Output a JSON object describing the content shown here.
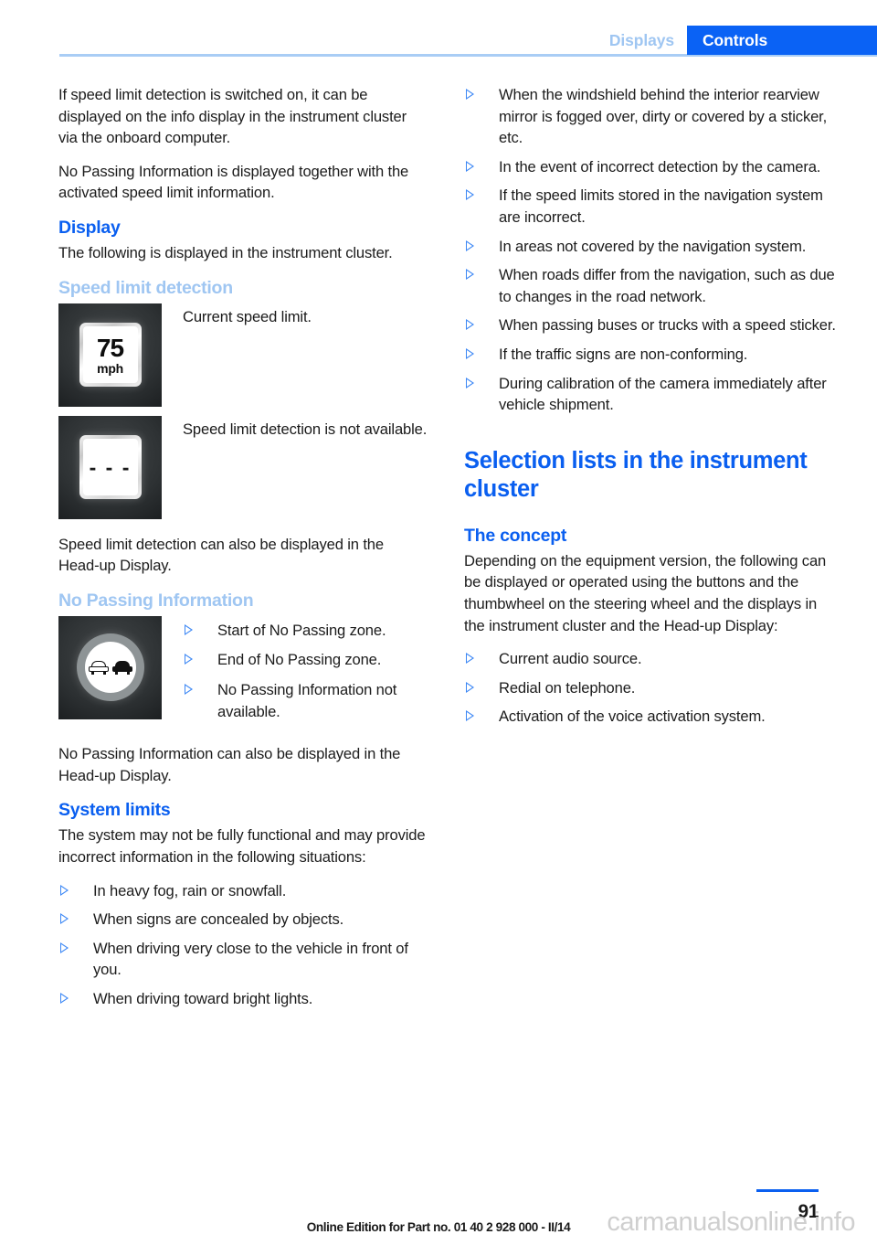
{
  "header": {
    "tab_inactive": "Displays",
    "tab_active": "Controls",
    "accent_blue": "#0a62f5",
    "light_blue": "#9fc6f2"
  },
  "left_column": {
    "intro_p1": "If speed limit detection is switched on, it can be displayed on the info display in the instrument cluster via the onboard computer.",
    "intro_p2": "No Passing Information is displayed together with the activated speed limit information.",
    "display_heading": "Display",
    "display_text": "The following is displayed in the instrument cluster.",
    "speed_limit_heading": "Speed limit detection",
    "fig_speed_limit": {
      "icon_value": "75",
      "icon_unit": "mph",
      "caption": "Current speed limit."
    },
    "fig_not_available": {
      "icon_value": "- - -",
      "caption": "Speed limit detection is not available."
    },
    "hud_note_1": "Speed limit detection can also be displayed in the Head-up Display.",
    "no_passing_heading": "No Passing Information",
    "fig_no_passing": {
      "items": [
        "Start of No Passing zone.",
        "End of No Passing zone.",
        "No Passing Information not available."
      ]
    },
    "hud_note_2": "No Passing Information can also be displayed in the Head-up Display.",
    "system_limits_heading": "System limits",
    "system_limits_text": "The system may not be fully functional and may provide incorrect information in the following situations:",
    "system_limits_items": [
      "In heavy fog, rain or snowfall.",
      "When signs are concealed by objects.",
      "When driving very close to the vehicle in front of you.",
      "When driving toward bright lights."
    ]
  },
  "right_column": {
    "system_limits_items_cont": [
      "When the windshield behind the interior rearview mirror is fogged over, dirty or covered by a sticker, etc.",
      "In the event of incorrect detection by the camera.",
      "If the speed limits stored in the navigation system are incorrect.",
      "In areas not covered by the navigation system.",
      "When roads differ from the navigation, such as due to changes in the road network.",
      "When passing buses or trucks with a speed sticker.",
      "If the traffic signs are non-conforming.",
      "During calibration of the camera immediately after vehicle shipment."
    ],
    "chapter_heading": "Selection lists in the instrument cluster",
    "concept_heading": "The concept",
    "concept_text": "Depending on the equipment version, the following can be displayed or operated using the buttons and the thumbwheel on the steering wheel and the displays in the instrument cluster and the Head-up Display:",
    "concept_items": [
      "Current audio source.",
      "Redial on telephone.",
      "Activation of the voice activation system."
    ]
  },
  "footer": {
    "page_number": "91",
    "edition_note": "Online Edition for Part no. 01 40 2 928 000 - II/14",
    "watermark": "carmanualsonline.info"
  }
}
